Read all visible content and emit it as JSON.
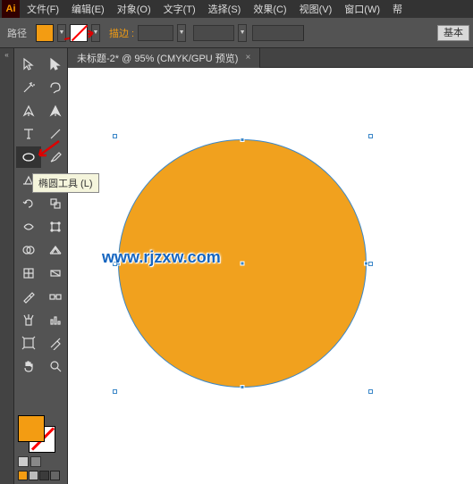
{
  "app_logo": "Ai",
  "menu": [
    "文件(F)",
    "编辑(E)",
    "对象(O)",
    "文字(T)",
    "选择(S)",
    "效果(C)",
    "视图(V)",
    "窗口(W)",
    "帮"
  ],
  "options_bar": {
    "left_label": "路径",
    "fill_color": "#f39c12",
    "stroke_label": "描边 :",
    "stroke_value": "",
    "basic_label": "基本"
  },
  "document_tab": {
    "title": "未标题-2* @ 95% (CMYK/GPU 预览)",
    "close": "×"
  },
  "tooltip": "椭圆工具 (L)",
  "watermark": "www.rjzxw.com",
  "colors": {
    "shape_fill": "#f1a11e",
    "selection": "#3b87c8"
  }
}
